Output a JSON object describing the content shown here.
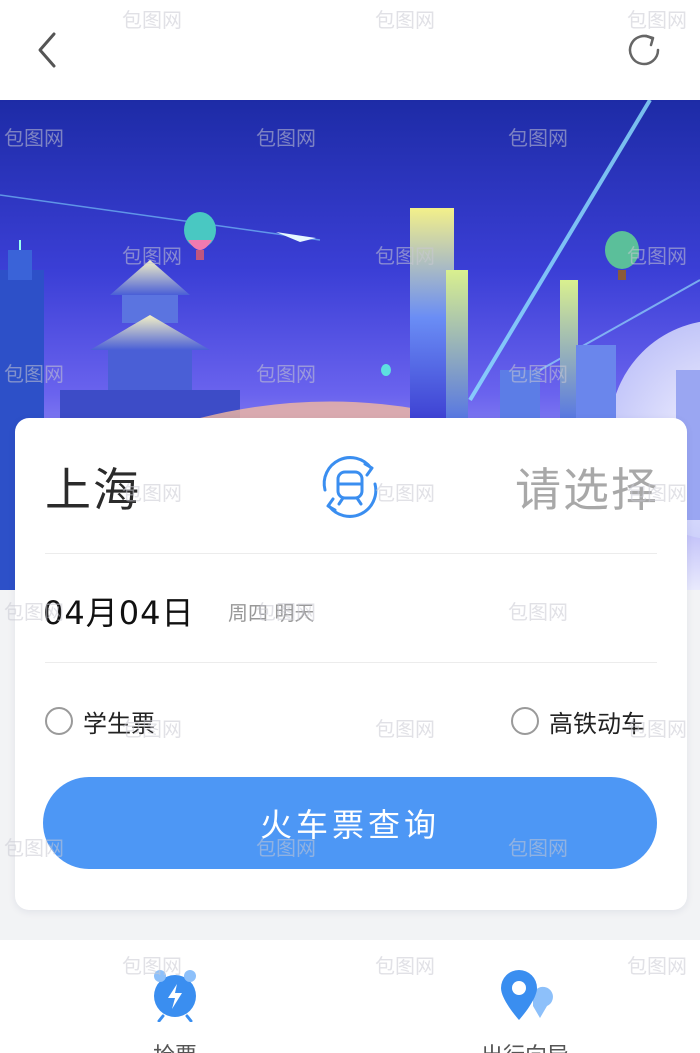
{
  "header": {
    "back_icon": "chevron-left-icon",
    "refresh_icon": "refresh-icon"
  },
  "hero": {
    "description_icon": "city-skyline-illustration"
  },
  "search": {
    "from_station": "上海",
    "to_station": "请选择",
    "swap_icon": "train-swap-icon",
    "date": "04月04日",
    "date_sub": "周四 明天",
    "option_student": "学生票",
    "option_highspeed": "高铁动车",
    "query_button": "火车票查询"
  },
  "tabs": [
    {
      "label": "抢票",
      "icon": "lightning-clock-icon"
    },
    {
      "label": "出行向导",
      "icon": "location-pin-icon"
    }
  ],
  "watermark": "包图网",
  "colors": {
    "accent": "#4d97f5",
    "icon_blue": "#3a8ef0",
    "muted_text": "#a8a8a8"
  }
}
